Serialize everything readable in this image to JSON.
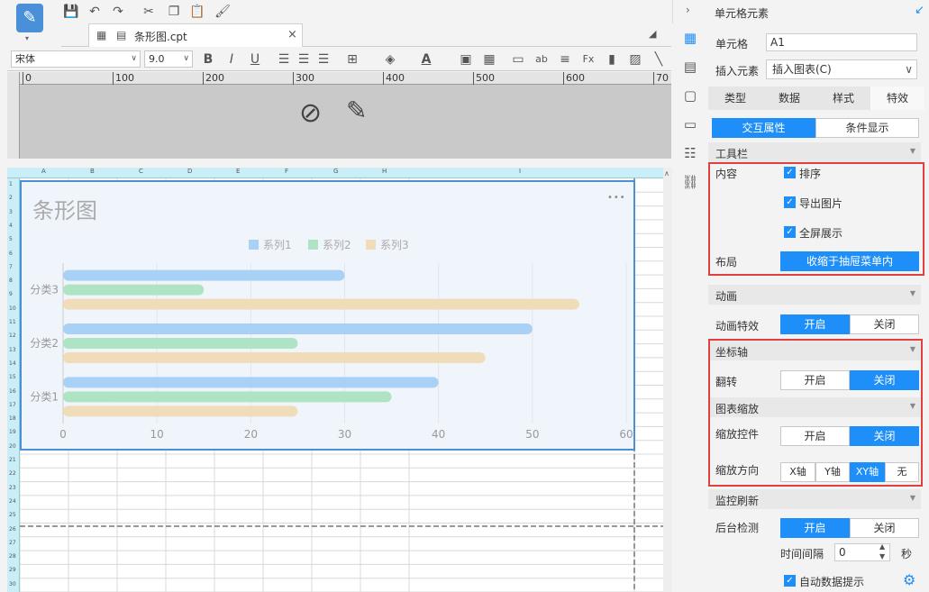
{
  "file_tab": {
    "name": "条形图.cpt",
    "close": "×"
  },
  "font": {
    "family": "宋体",
    "size": "9.0"
  },
  "ruler": {
    "ticks": [
      "0",
      "100",
      "200",
      "300",
      "400",
      "500",
      "600",
      "70"
    ]
  },
  "columns": [
    "A",
    "B",
    "C",
    "D",
    "E",
    "F",
    "G",
    "H",
    "I"
  ],
  "rows": [
    "1",
    "2",
    "3",
    "4",
    "5",
    "6",
    "7",
    "8",
    "9",
    "10",
    "11",
    "12",
    "13",
    "14",
    "15",
    "16",
    "17",
    "18",
    "19",
    "20",
    "21",
    "22",
    "23",
    "24",
    "25",
    "26",
    "27",
    "28",
    "29",
    "30"
  ],
  "chart": {
    "title": "条形图",
    "more": "•••",
    "legend": [
      "系列1",
      "系列2",
      "系列3"
    ]
  },
  "chart_data": {
    "type": "bar",
    "title": "条形图",
    "categories": [
      "分类1",
      "分类2",
      "分类3"
    ],
    "series": [
      {
        "name": "系列1",
        "values": [
          40,
          50,
          30
        ],
        "color": "#a8d1f5"
      },
      {
        "name": "系列2",
        "values": [
          35,
          25,
          15
        ],
        "color": "#aee3c4"
      },
      {
        "name": "系列3",
        "values": [
          25,
          45,
          55
        ],
        "color": "#f0dcb8"
      }
    ],
    "xlim": [
      0,
      60
    ],
    "xticks": [
      "0",
      "10",
      "20",
      "30",
      "40",
      "50",
      "60"
    ],
    "orientation": "horizontal"
  },
  "panel": {
    "title": "单元格元素",
    "cell_label": "单元格",
    "cell_value": "A1",
    "insert_label": "插入元素",
    "insert_value": "插入图表(C)",
    "tabs": [
      "类型",
      "数据",
      "样式",
      "特效"
    ],
    "subtabs": [
      "交互属性",
      "条件显示"
    ],
    "toolbar_section": "工具栏",
    "content_label": "内容",
    "checks": [
      "排序",
      "导出图片",
      "全屏展示"
    ],
    "layout_label": "布局",
    "layout_value": "收缩于抽屉菜单内",
    "anim_section": "动画",
    "anim_label": "动画特效",
    "on": "开启",
    "off": "关闭",
    "axis_section": "坐标轴",
    "flip_label": "翻转",
    "zoom_section": "图表缩放",
    "zoom_ctrl_label": "缩放控件",
    "zoom_dir_label": "缩放方向",
    "zoom_dirs": [
      "X轴",
      "Y轴",
      "XY轴",
      "无"
    ],
    "monitor_section": "监控刷新",
    "bg_label": "后台检测",
    "interval_label": "时间间隔",
    "interval_value": "0",
    "interval_unit": "秒",
    "auto_tip": "自动数据提示"
  }
}
